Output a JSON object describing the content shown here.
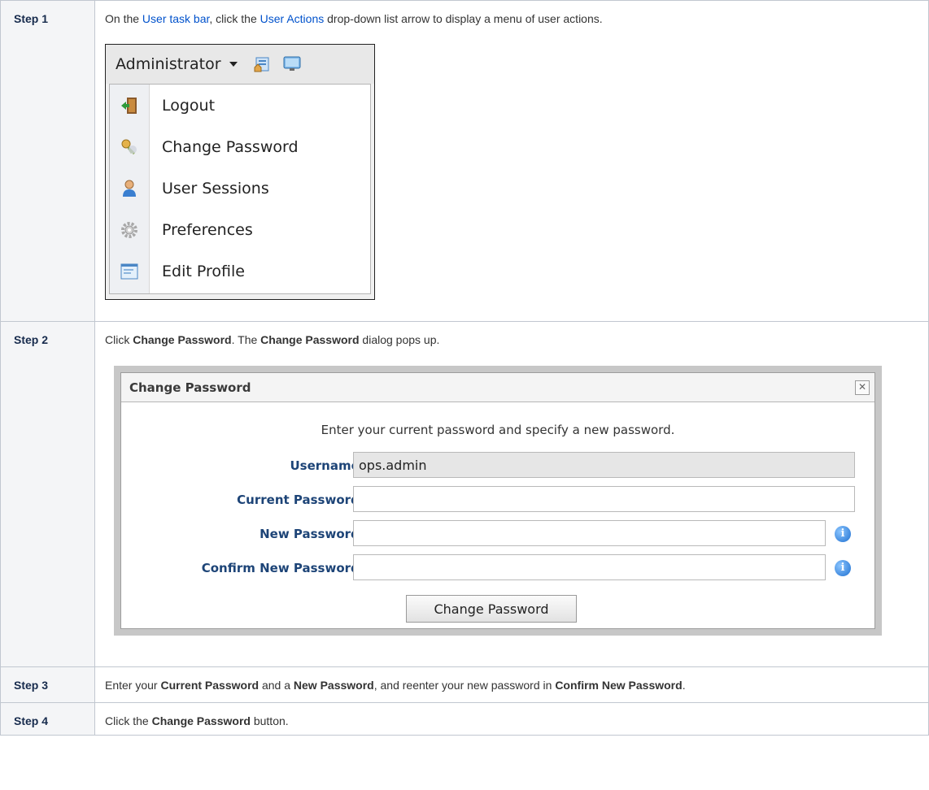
{
  "steps": [
    {
      "label": "Step 1",
      "parts": [
        "On the ",
        "User task bar",
        ", click the ",
        "User Actions",
        " drop-down list arrow to display a menu of user actions."
      ]
    },
    {
      "label": "Step  2",
      "parts": [
        "Click ",
        "Change Password",
        ". The ",
        "Change Password",
        " dialog pops up."
      ]
    },
    {
      "label": "Step 3",
      "parts": [
        "Enter your ",
        "Current Password",
        " and a ",
        "New Password",
        ", and reenter your new password in ",
        "Confirm New Password",
        "."
      ]
    },
    {
      "label": "Step 4",
      "parts": [
        "Click the ",
        "Change Password",
        " button."
      ]
    }
  ],
  "user_menu": {
    "user": "Administrator",
    "toolbar_icons": [
      "home-page-icon",
      "monitor-icon"
    ],
    "items": [
      {
        "label": "Logout",
        "icon": "logout-door-icon"
      },
      {
        "label": "Change Password",
        "icon": "key-icon"
      },
      {
        "label": "User Sessions",
        "icon": "user-icon"
      },
      {
        "label": "Preferences",
        "icon": "gear-icon"
      },
      {
        "label": "Edit Profile",
        "icon": "profile-form-icon"
      }
    ]
  },
  "dialog": {
    "title": "Change Password",
    "close": "✕",
    "intro": "Enter your current password and specify a new password.",
    "fields": [
      {
        "label": "Username :",
        "value": "ops.admin"
      },
      {
        "label": "Current Password :",
        "value": ""
      },
      {
        "label": "New Password :",
        "value": ""
      },
      {
        "label": "Confirm New Password :",
        "value": ""
      }
    ],
    "info_glyph": "i",
    "button": "Change Password"
  },
  "colors": {
    "link": "#0052cc",
    "label_bg": "#f4f5f7",
    "field_label": "#1d4477",
    "info": "#1e6fd0"
  }
}
